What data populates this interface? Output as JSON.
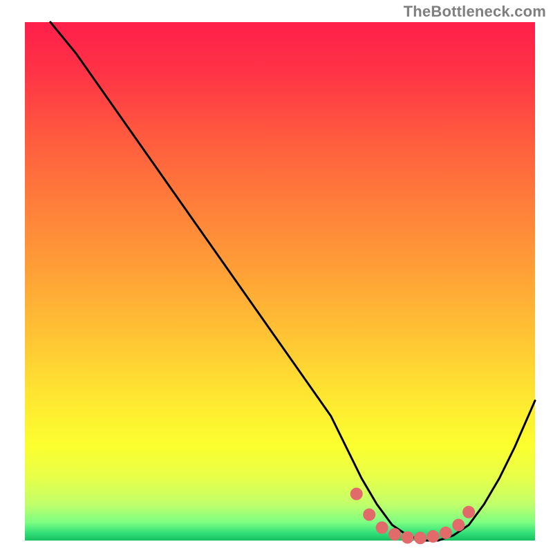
{
  "attribution": "TheBottleneck.com",
  "chart_data": {
    "type": "line",
    "title": "",
    "xlabel": "",
    "ylabel": "",
    "xlim": [
      0,
      100
    ],
    "ylim": [
      0,
      100
    ],
    "series": [
      {
        "name": "bottleneck-curve",
        "x": [
          5,
          10,
          15,
          20,
          25,
          30,
          35,
          40,
          45,
          50,
          55,
          60,
          63,
          66,
          69,
          72,
          75,
          78,
          81,
          84,
          87,
          90,
          93,
          96,
          100
        ],
        "y": [
          100,
          94,
          87,
          80,
          73,
          66,
          59,
          52,
          45,
          38,
          31,
          24,
          18,
          12,
          7,
          3,
          1,
          0,
          0,
          1,
          3,
          7,
          12,
          18,
          27
        ]
      }
    ],
    "optimal_zone": {
      "name": "optimal-markers",
      "x": [
        65,
        67.5,
        70,
        72.5,
        75,
        77.5,
        80,
        82.5,
        85,
        87
      ],
      "y": [
        9,
        5,
        2.5,
        1.2,
        0.6,
        0.5,
        0.8,
        1.5,
        3,
        5.5
      ]
    },
    "gradient_stops": [
      {
        "offset": 0.0,
        "color": "#ff1f4b"
      },
      {
        "offset": 0.1,
        "color": "#ff3446"
      },
      {
        "offset": 0.22,
        "color": "#ff5a3f"
      },
      {
        "offset": 0.35,
        "color": "#ff7e3a"
      },
      {
        "offset": 0.48,
        "color": "#ffa037"
      },
      {
        "offset": 0.6,
        "color": "#ffc234"
      },
      {
        "offset": 0.72,
        "color": "#ffe631"
      },
      {
        "offset": 0.82,
        "color": "#fbff2f"
      },
      {
        "offset": 0.88,
        "color": "#e6ff4a"
      },
      {
        "offset": 0.93,
        "color": "#c1ff6a"
      },
      {
        "offset": 0.965,
        "color": "#7dff82"
      },
      {
        "offset": 0.985,
        "color": "#33e07a"
      },
      {
        "offset": 1.0,
        "color": "#18c060"
      }
    ],
    "marker_color": "#e26a6a",
    "curve_color": "#000000"
  }
}
